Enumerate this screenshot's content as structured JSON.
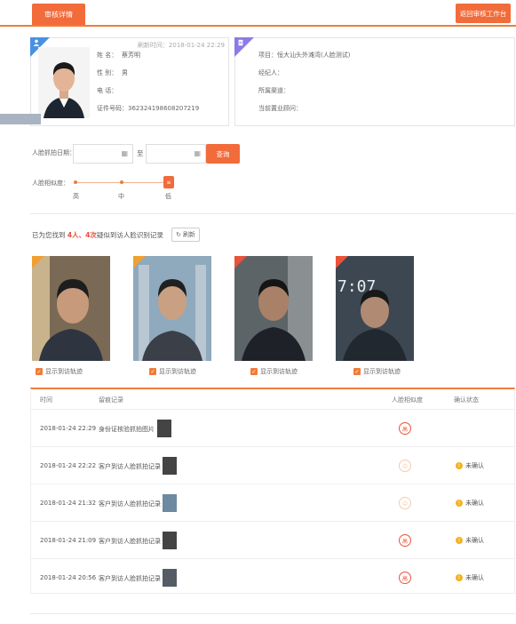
{
  "header": {
    "tab_label": "审核详情",
    "back_button": "返回审核工作台"
  },
  "customer": {
    "updated_at": "刷新时间：2018-01-24 22:29",
    "fields": [
      {
        "label": "姓",
        "label2": "名：",
        "value": "蔡芳明"
      },
      {
        "label": "性",
        "label2": "别：",
        "value": "男"
      },
      {
        "label": "电",
        "label2": "话：",
        "value": ""
      },
      {
        "label": "证件号码：",
        "label2": "",
        "value": "362324198608207219"
      }
    ]
  },
  "project": {
    "fields": [
      {
        "label": "项目：",
        "value": "恒大汕头外滩湾(人脸测试)"
      },
      {
        "label": "经纪人：",
        "value": ""
      },
      {
        "label": "所属渠道：",
        "value": ""
      },
      {
        "label": "当前置业顾问：",
        "value": ""
      }
    ]
  },
  "filters": {
    "date_label": "人脸抓拍日期：",
    "to_label": "至",
    "query_button": "查询",
    "similarity_label": "人脸相似度：",
    "levels": [
      "高",
      "中",
      "低"
    ],
    "thumb_text": "≡"
  },
  "result": {
    "prefix": "已为您找到",
    "count": "4人、4次",
    "suffix": "疑似到访人脸识别记录",
    "refresh_button": "刷新"
  },
  "snapshots": [
    {
      "badge": "中",
      "badge_color": "#f0a030",
      "check_label": "显示到访轨迹"
    },
    {
      "badge": "中",
      "badge_color": "#f0a030",
      "check_label": "显示到访轨迹"
    },
    {
      "badge": "高",
      "badge_color": "#e8533a",
      "check_label": "显示到访轨迹"
    },
    {
      "badge": "高",
      "badge_color": "#e8533a",
      "check_label": "显示到访轨迹"
    }
  ],
  "table": {
    "headers": {
      "time": "时间",
      "record": "留痕记录",
      "similarity": "人脸相似度",
      "status": "确认状态"
    },
    "rows": [
      {
        "time": "2018-01-24 22:29",
        "record": "身份证核验抓拍图片",
        "similarity": "高",
        "faint": false,
        "status": ""
      },
      {
        "time": "2018-01-24 22:22",
        "record": "客户到访人脸抓拍记录",
        "similarity": "中",
        "faint": true,
        "status": "未确认"
      },
      {
        "time": "2018-01-24 21:32",
        "record": "客户到访人脸抓拍记录",
        "similarity": "中",
        "faint": true,
        "status": "未确认"
      },
      {
        "time": "2018-01-24 21:09",
        "record": "客户到访人脸抓拍记录",
        "similarity": "高",
        "faint": false,
        "status": "未确认"
      },
      {
        "time": "2018-01-24 20:56",
        "record": "客户到访人脸抓拍记录",
        "similarity": "高",
        "faint": false,
        "status": "未确认"
      }
    ]
  }
}
